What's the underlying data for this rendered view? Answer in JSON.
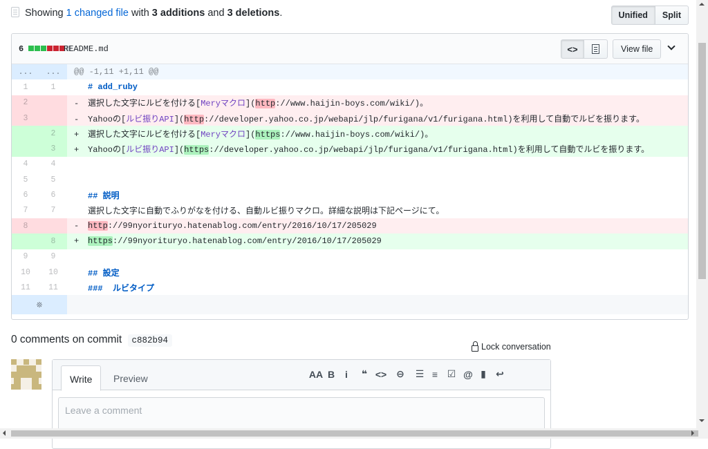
{
  "toc": {
    "prefix": "Showing ",
    "changed": "1 changed file",
    "with": " with ",
    "additions": "3 additions",
    "and": " and ",
    "deletions": "3 deletions",
    "suffix": ".",
    "unified_label": "Unified",
    "split_label": "Split"
  },
  "file": {
    "diffstat": "6",
    "blocks": [
      "#2cbe4e",
      "#2cbe4e",
      "#2cbe4e",
      "#cb2431",
      "#cb2431",
      "#cb2431",
      "#d1d5da"
    ],
    "path": "README.md",
    "code_view_icon": "code-icon",
    "rich_view_icon": "file-text-icon",
    "view_file_label": "View file",
    "collapse_icon": "chevron-down-icon"
  },
  "diff": {
    "hunk_marker_left": "...",
    "hunk_marker_right": "...",
    "hunk_header": "@@ -1,11 +1,11 @@",
    "lines": [
      {
        "type": "ctx",
        "l": "1",
        "r": "1",
        "code": [
          {
            "t": "# add_ruby",
            "c": "k"
          }
        ]
      },
      {
        "type": "del",
        "l": "2",
        "r": "",
        "code": [
          {
            "t": "選択した文字にルビを付ける["
          },
          {
            "t": "Meryマクロ",
            "c": "lnk"
          },
          {
            "t": "]("
          },
          {
            "t": "http",
            "c": "hl-del"
          },
          {
            "t": "://www.haijin-boys.com/wiki/)。"
          }
        ]
      },
      {
        "type": "del",
        "l": "3",
        "r": "",
        "code": [
          {
            "t": "Yahooの["
          },
          {
            "t": "ルビ振りAPI",
            "c": "lnk"
          },
          {
            "t": "]("
          },
          {
            "t": "http",
            "c": "hl-del"
          },
          {
            "t": "://developer.yahoo.co.jp/webapi/jlp/furigana/v1/furigana.html)を利用して自動でルビを振ります。"
          }
        ]
      },
      {
        "type": "add",
        "l": "",
        "r": "2",
        "code": [
          {
            "t": "選択した文字にルビを付ける["
          },
          {
            "t": "Meryマクロ",
            "c": "lnk"
          },
          {
            "t": "]("
          },
          {
            "t": "https",
            "c": "hl-add"
          },
          {
            "t": "://www.haijin-boys.com/wiki/)。"
          }
        ]
      },
      {
        "type": "add",
        "l": "",
        "r": "3",
        "code": [
          {
            "t": "Yahooの["
          },
          {
            "t": "ルビ振りAPI",
            "c": "lnk"
          },
          {
            "t": "]("
          },
          {
            "t": "https",
            "c": "hl-add"
          },
          {
            "t": "://developer.yahoo.co.jp/webapi/jlp/furigana/v1/furigana.html)を利用して自動でルビを振ります。"
          }
        ]
      },
      {
        "type": "ctx",
        "l": "4",
        "r": "4",
        "code": []
      },
      {
        "type": "ctx",
        "l": "5",
        "r": "5",
        "code": []
      },
      {
        "type": "ctx",
        "l": "6",
        "r": "6",
        "code": [
          {
            "t": "## 説明",
            "c": "k"
          }
        ]
      },
      {
        "type": "ctx",
        "l": "7",
        "r": "7",
        "code": [
          {
            "t": "選択した文字に自動でふりがなを付ける、自動ルビ振りマクロ。詳細な説明は下記ページにて。"
          }
        ]
      },
      {
        "type": "del",
        "l": "8",
        "r": "",
        "code": [
          {
            "t": "http",
            "c": "hl-del"
          },
          {
            "t": "://99nyorituryo.hatenablog.com/entry/2016/10/17/205029"
          }
        ]
      },
      {
        "type": "add",
        "l": "",
        "r": "8",
        "code": [
          {
            "t": "https",
            "c": "hl-add"
          },
          {
            "t": "://99nyorituryo.hatenablog.com/entry/2016/10/17/205029"
          }
        ]
      },
      {
        "type": "ctx",
        "l": "9",
        "r": "9",
        "code": []
      },
      {
        "type": "ctx",
        "l": "10",
        "r": "10",
        "code": [
          {
            "t": "## 設定",
            "c": "k"
          }
        ]
      },
      {
        "type": "ctx",
        "l": "11",
        "r": "11",
        "code": [
          {
            "t": "###  ルビタイプ",
            "c": "k"
          }
        ]
      }
    ],
    "expand_icon": "unfold-icon"
  },
  "comments": {
    "title_prefix": "0 comments on commit",
    "sha": "c882b94",
    "lock_label": "Lock conversation",
    "write_tab": "Write",
    "preview_tab": "Preview",
    "placeholder": "Leave a comment",
    "toolbar": [
      {
        "icon": "text-size-icon",
        "glyph": "AA"
      },
      {
        "icon": "bold-icon",
        "glyph": "B"
      },
      {
        "icon": "italic-icon",
        "glyph": "i"
      },
      {
        "icon": "quote-icon",
        "glyph": "❝"
      },
      {
        "icon": "code-icon",
        "glyph": "<>"
      },
      {
        "icon": "link-icon",
        "glyph": "⊖"
      },
      {
        "icon": "unordered-list-icon",
        "glyph": "☰"
      },
      {
        "icon": "ordered-list-icon",
        "glyph": "≡"
      },
      {
        "icon": "task-list-icon",
        "glyph": "☑"
      },
      {
        "icon": "mention-icon",
        "glyph": "@"
      },
      {
        "icon": "bookmark-icon",
        "glyph": "▮"
      },
      {
        "icon": "reply-icon",
        "glyph": "↩"
      }
    ]
  }
}
